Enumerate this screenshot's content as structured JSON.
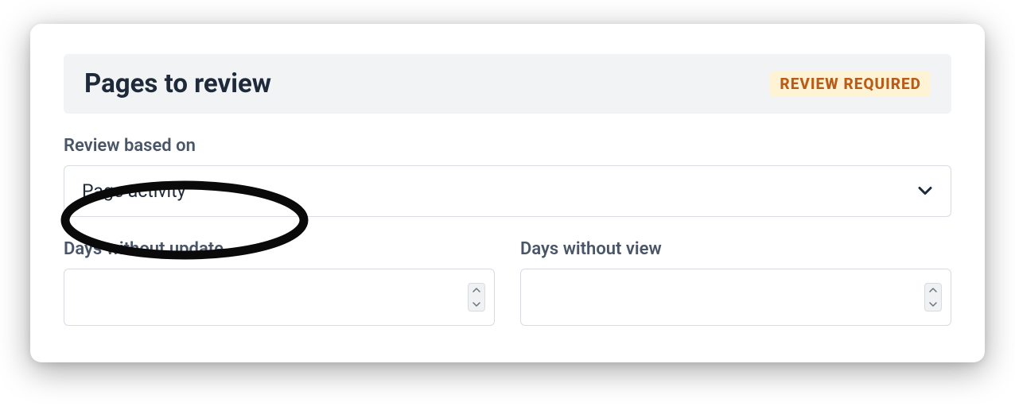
{
  "header": {
    "title": "Pages to review",
    "badge": "REVIEW REQUIRED"
  },
  "fields": {
    "review_based_on": {
      "label": "Review based on",
      "value": "Page activity"
    },
    "days_without_update": {
      "label": "Days without update",
      "value": ""
    },
    "days_without_view": {
      "label": "Days without view",
      "value": ""
    }
  },
  "colors": {
    "badge_bg": "#fff3d6",
    "badge_text": "#b85c1a",
    "text_primary": "#1e2a3a",
    "text_secondary": "#4a5568"
  }
}
